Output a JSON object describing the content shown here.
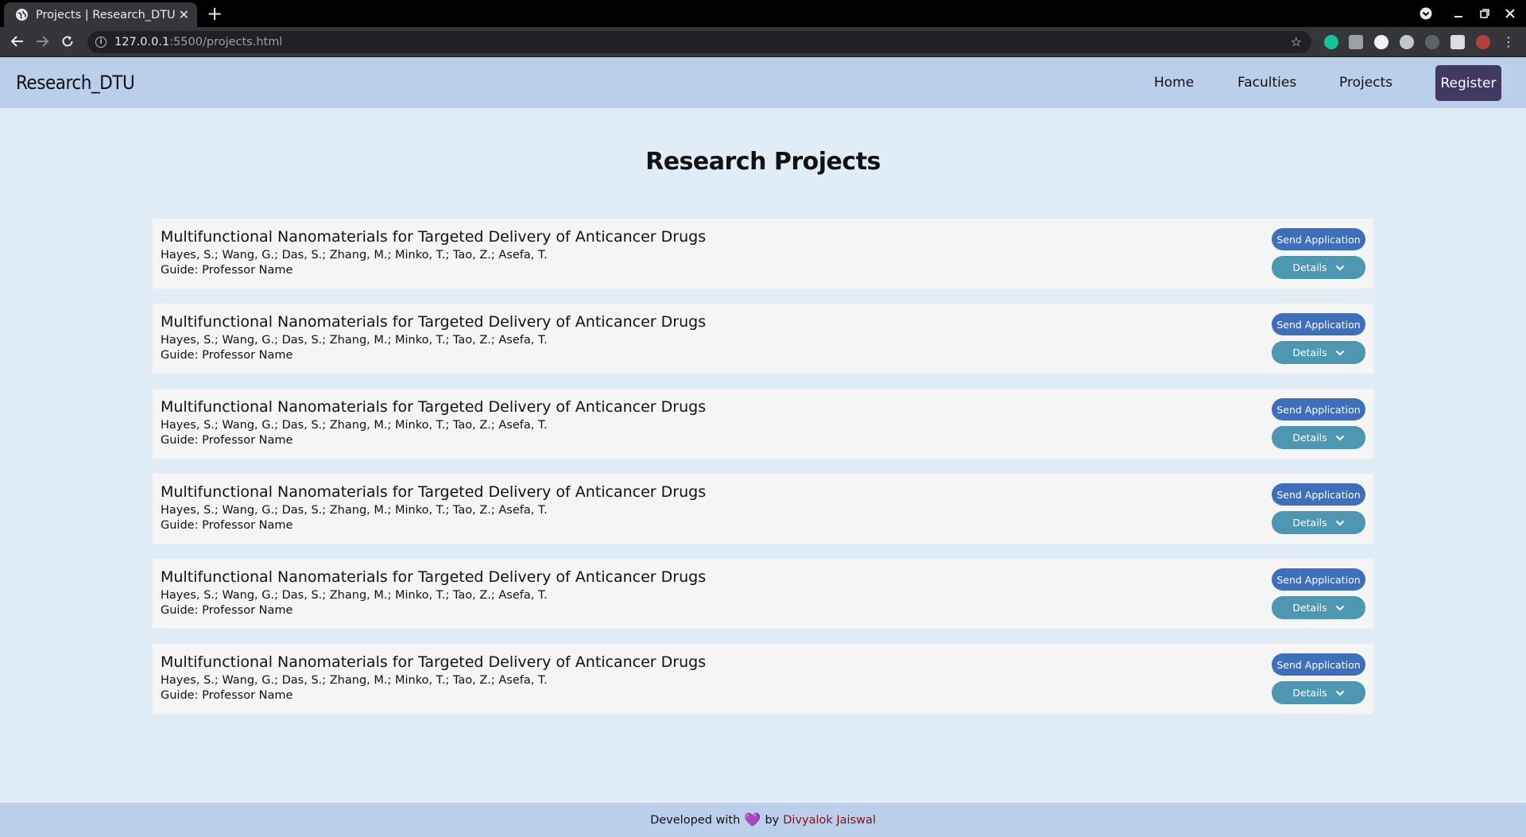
{
  "browser": {
    "tab_title": "Projects | Research_DTU",
    "tab_close": "✕",
    "new_tab": "+",
    "url_host": "127.0.0.1",
    "url_rest": ":5500/projects.html"
  },
  "site": {
    "brand": "Research_DTU",
    "nav": [
      "Home",
      "Faculties",
      "Projects"
    ],
    "register": "Register"
  },
  "main": {
    "heading": "Research Projects",
    "projects": [
      {
        "title": "Multifunctional Nanomaterials for Targeted Delivery of Anticancer Drugs",
        "authors": "Hayes, S.; Wang, G.; Das, S.; Zhang, M.; Minko, T.; Tao, Z.; Asefa, T.",
        "guide": "Guide: Professor Name",
        "send": "Send Application",
        "details": "Details"
      },
      {
        "title": "Multifunctional Nanomaterials for Targeted Delivery of Anticancer Drugs",
        "authors": "Hayes, S.; Wang, G.; Das, S.; Zhang, M.; Minko, T.; Tao, Z.; Asefa, T.",
        "guide": "Guide: Professor Name",
        "send": "Send Application",
        "details": "Details"
      },
      {
        "title": "Multifunctional Nanomaterials for Targeted Delivery of Anticancer Drugs",
        "authors": "Hayes, S.; Wang, G.; Das, S.; Zhang, M.; Minko, T.; Tao, Z.; Asefa, T.",
        "guide": "Guide: Professor Name",
        "send": "Send Application",
        "details": "Details"
      },
      {
        "title": "Multifunctional Nanomaterials for Targeted Delivery of Anticancer Drugs",
        "authors": "Hayes, S.; Wang, G.; Das, S.; Zhang, M.; Minko, T.; Tao, Z.; Asefa, T.",
        "guide": "Guide: Professor Name",
        "send": "Send Application",
        "details": "Details"
      },
      {
        "title": "Multifunctional Nanomaterials for Targeted Delivery of Anticancer Drugs",
        "authors": "Hayes, S.; Wang, G.; Das, S.; Zhang, M.; Minko, T.; Tao, Z.; Asefa, T.",
        "guide": "Guide: Professor Name",
        "send": "Send Application",
        "details": "Details"
      },
      {
        "title": "Multifunctional Nanomaterials for Targeted Delivery of Anticancer Drugs",
        "authors": "Hayes, S.; Wang, G.; Das, S.; Zhang, M.; Minko, T.; Tao, Z.; Asefa, T.",
        "guide": "Guide: Professor Name",
        "send": "Send Application",
        "details": "Details"
      }
    ]
  },
  "footer": {
    "prefix": "Developed with",
    "heart": "💜",
    "by": "by",
    "author": "Divyalok Jaiswal"
  },
  "colors": {
    "nav_bg": "#bad0ea",
    "page_bg": "#e1edf6",
    "register_bg": "#403964",
    "send_bg": "#3e6fbb",
    "details_bg": "#4d97b3",
    "author_link": "#8b0f0f"
  }
}
